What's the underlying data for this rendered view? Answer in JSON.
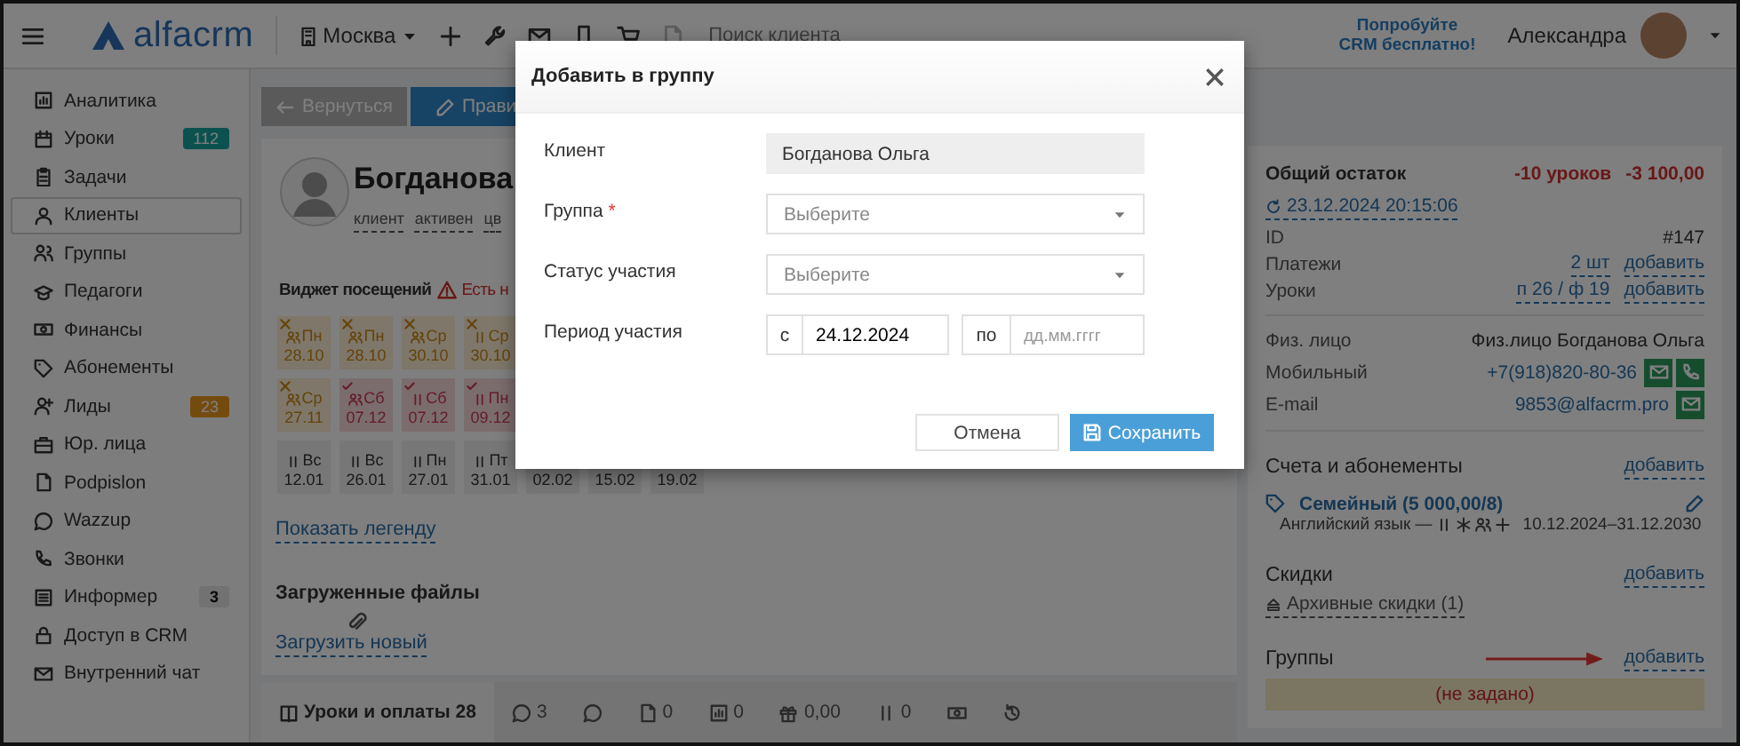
{
  "topbar": {
    "logo": "alfacrm",
    "city": "Москва",
    "search": {
      "placeholder": "Поиск клиента"
    },
    "promo": [
      "Попробуйте",
      "CRM бесплатно!"
    ],
    "user": "Александра"
  },
  "sidebar": {
    "items": [
      {
        "label": "Аналитика",
        "selected": false
      },
      {
        "label": "Уроки",
        "selected": false,
        "badge": {
          "text": "112",
          "kind": "info"
        }
      },
      {
        "label": "Задачи",
        "selected": false
      },
      {
        "label": "Клиенты",
        "selected": true
      },
      {
        "label": "Группы",
        "selected": false
      },
      {
        "label": "Педагоги",
        "selected": false
      },
      {
        "label": "Финансы",
        "selected": false
      },
      {
        "label": "Абонементы",
        "selected": false
      },
      {
        "label": "Лиды",
        "selected": false,
        "badge": {
          "text": "23",
          "kind": "warning"
        }
      },
      {
        "label": "Юр. лица",
        "selected": false
      },
      {
        "label": "Podpislon",
        "selected": false
      },
      {
        "label": "Wazzup",
        "selected": false
      },
      {
        "label": "Звонки",
        "selected": false
      },
      {
        "label": "Информер",
        "selected": false,
        "badge": {
          "text": "3",
          "kind": "muted"
        }
      },
      {
        "label": "Доступ в CRM",
        "selected": false
      },
      {
        "label": "Внутренний чат",
        "selected": false
      }
    ]
  },
  "actions": [
    {
      "label": "Вернуться",
      "kind": "back"
    },
    {
      "label": "Прави",
      "kind": "edit"
    }
  ],
  "profile": {
    "name": "Богданова",
    "tags": [
      "клиент",
      "активен",
      "цв"
    ]
  },
  "attendance": {
    "title": "Виджет посещений",
    "warning": "Есть н",
    "rows": [
      [
        {
          "day": "Пн",
          "date": "28.10",
          "group": false,
          "kind": "warning"
        },
        {
          "day": "Пн",
          "date": "28.10",
          "group": false,
          "kind": "warning"
        },
        {
          "day": "Ср",
          "date": "30.10",
          "group": false,
          "kind": "warning"
        },
        {
          "day": "Ср",
          "date": "30.10",
          "group": true,
          "kind": "warning"
        }
      ],
      [
        {
          "day": "Ср",
          "date": "27.11",
          "group": false,
          "kind": "warning"
        },
        {
          "day": "Сб",
          "date": "07.12",
          "group": false,
          "kind": "attended"
        },
        {
          "day": "Сб",
          "date": "07.12",
          "group": true,
          "kind": "attended"
        },
        {
          "day": "Пн",
          "date": "09.12",
          "group": true,
          "kind": "attended"
        }
      ],
      [
        {
          "day": "Вс",
          "date": "12.01",
          "group": true,
          "kind": "planned"
        },
        {
          "day": "Вс",
          "date": "26.01",
          "group": true,
          "kind": "planned"
        },
        {
          "day": "Пн",
          "date": "27.01",
          "group": true,
          "kind": "planned"
        },
        {
          "day": "Пт",
          "date": "31.01",
          "group": true,
          "kind": "planned"
        },
        {
          "date": "02.02",
          "kind": "planned"
        },
        {
          "date": "15.02",
          "kind": "planned"
        },
        {
          "date": "19.02",
          "kind": "planned"
        }
      ]
    ],
    "legend_link": "Показать легенду"
  },
  "files": {
    "title": "Загруженные файлы",
    "upload": "Загрузить новый"
  },
  "tabs": [
    {
      "label": "Уроки и оплаты 28",
      "selected": true
    },
    {
      "label": "3",
      "selected": false
    },
    {
      "selected": false
    },
    {
      "label": "0",
      "selected": false
    },
    {
      "label": "0",
      "selected": false
    },
    {
      "label": "0,00",
      "selected": false
    },
    {
      "label": "0",
      "selected": false
    },
    {
      "selected": false
    },
    {
      "selected": false
    }
  ],
  "balance": {
    "title": "Общий остаток",
    "lessons": "-10 уроков",
    "amount": "-3 100,00",
    "updated": "23.12.2024 20:15:06",
    "rows": [
      {
        "label": "ID",
        "values": [
          {
            "text": "#147",
            "link": false
          }
        ]
      },
      {
        "label": "Платежи",
        "values": [
          {
            "text": "2 шт",
            "link": true
          },
          {
            "text": "добавить",
            "link": true
          }
        ]
      },
      {
        "label": "Уроки",
        "values": [
          {
            "text": "п 26 / ф 19",
            "link": true
          },
          {
            "text": "добавить",
            "link": true
          }
        ]
      }
    ]
  },
  "contacts": [
    {
      "label": "Физ. лицо",
      "value": "Физ.лицо Богданова Ольга",
      "kind": "text"
    },
    {
      "label": "Мобильный",
      "value": "+7(918)820-80-36",
      "kind": "phone"
    },
    {
      "label": "E-mail",
      "value": "9853@alfacrm.pro",
      "kind": "email"
    }
  ],
  "subscriptions": {
    "title": "Счета и абонементы",
    "action": "добавить",
    "items": [
      {
        "name": "Семейный (5 000,00/8)",
        "subject": "Английский язык —",
        "period": "10.12.2024–31.12.2030"
      }
    ]
  },
  "discounts": {
    "title": "Скидки",
    "action": "добавить",
    "archive": "Архивные скидки (1)"
  },
  "groups": {
    "title": "Группы",
    "action": "добавить",
    "empty": "(не задано)"
  },
  "dialog": {
    "title": "Добавить в группу",
    "fields": [
      {
        "label": "Клиент",
        "kind": "readonly",
        "value": "Богданова Ольга"
      },
      {
        "label": "Группа",
        "mark": "*",
        "kind": "select",
        "placeholder": "Выберите"
      },
      {
        "label": "Статус участия",
        "kind": "select",
        "placeholder": "Выберите"
      },
      {
        "label": "Период участия",
        "kind": "period",
        "from_label": "с",
        "from": "24.12.2024",
        "to_label": "по",
        "to_placeholder": "дд.мм.гггг"
      }
    ],
    "buttons": [
      {
        "label": "Отмена",
        "kind": "secondary"
      },
      {
        "label": "Сохранить",
        "kind": "primary"
      }
    ]
  }
}
